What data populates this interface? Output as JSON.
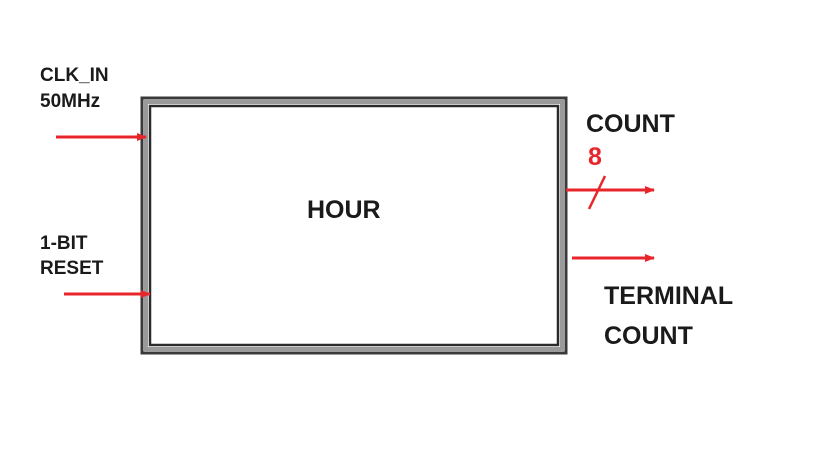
{
  "block": {
    "title": "HOUR"
  },
  "inputs": {
    "clock": {
      "line1": "CLK_IN",
      "line2": "50MHz"
    },
    "reset": {
      "line1": "1-BIT",
      "line2": "RESET"
    }
  },
  "outputs": {
    "count": {
      "label": "COUNT",
      "bus_width": "8"
    },
    "terminal_count": {
      "line1": "TERMINAL",
      "line2": "COUNT"
    }
  },
  "colors": {
    "arrow": "#e8252b",
    "bus_width_text": "#e8252b",
    "block_border": "#3a3a3a",
    "block_border_light": "#9a9a9a",
    "text": "#1a1a1a"
  }
}
